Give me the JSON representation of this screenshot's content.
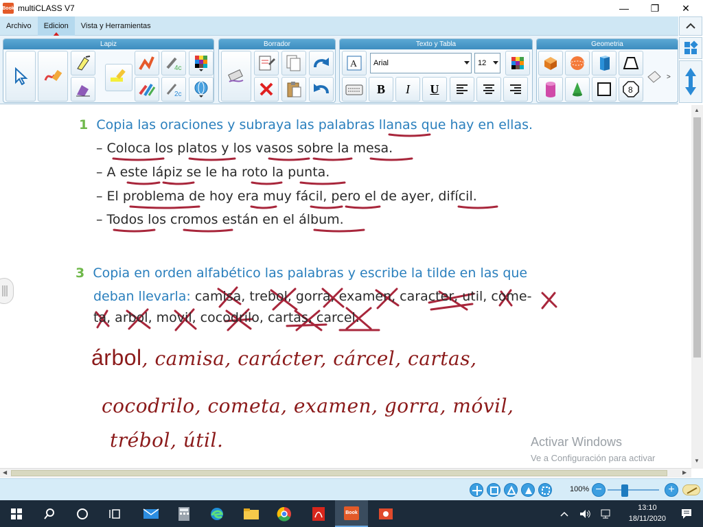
{
  "window": {
    "title": "multiCLASS V7",
    "logo_text": "Book",
    "minimize": "—",
    "maximize": "❐",
    "close": "✕"
  },
  "menu": {
    "items": [
      "Archivo",
      "Edicion",
      "Vista y Herramientas"
    ],
    "active": "Edicion"
  },
  "ribbon": {
    "groups": [
      "Lapiz",
      "Borrador",
      "Texto y Tabla",
      "Geometria"
    ],
    "font_name": "Arial",
    "font_size": "12",
    "bold": "B",
    "italic": "I",
    "underline": "U",
    "more_arrow": ">",
    "shape_number": "8"
  },
  "document": {
    "ex1": {
      "number": "1",
      "title": "Copia las oraciones y subraya las palabras llanas que hay en ellas.",
      "lines": [
        "–  Coloca los platos y los vasos sobre la mesa.",
        "–  A este lápiz se le ha roto la punta.",
        "–  El problema de hoy era muy fácil, pero el de ayer, difícil.",
        "–  Todos los cromos están en el álbum."
      ]
    },
    "ex3": {
      "number": "3",
      "title_line1": "Copia en orden alfabético las palabras y escribe la tilde en las que",
      "title_line2_prefix": "deban llevarla:",
      "title_line2_words": " camisa, trebol, gorra, examen, caracter, util, come-",
      "line3": "ta, arbol, movil, cocodrilo, cartas, carcel."
    },
    "handwriting": {
      "line1_first": "árbol",
      "line1_rest": ", camisa, carácter, cárcel, cartas,",
      "line2": "cocodrilo, cometa, examen, gorra, móvil,",
      "line3": "trébol, útil."
    },
    "activation": {
      "title": "Activar Windows",
      "subtitle": "Ve a Configuración para activar Windows."
    }
  },
  "statusbar": {
    "zoom": "100%",
    "zoom_out": "−",
    "zoom_in": "+"
  },
  "taskbar": {
    "time": "13:10",
    "date": "18/11/2020",
    "active_app": "Book"
  },
  "colors": {
    "menubar": "#cfe7f4",
    "accent": "#3d8dbf",
    "ink": "#8b1a1a",
    "exercise_title": "#2a7fbd",
    "exercise_number": "#6fb84a",
    "taskbar": "#1c2b3a"
  }
}
